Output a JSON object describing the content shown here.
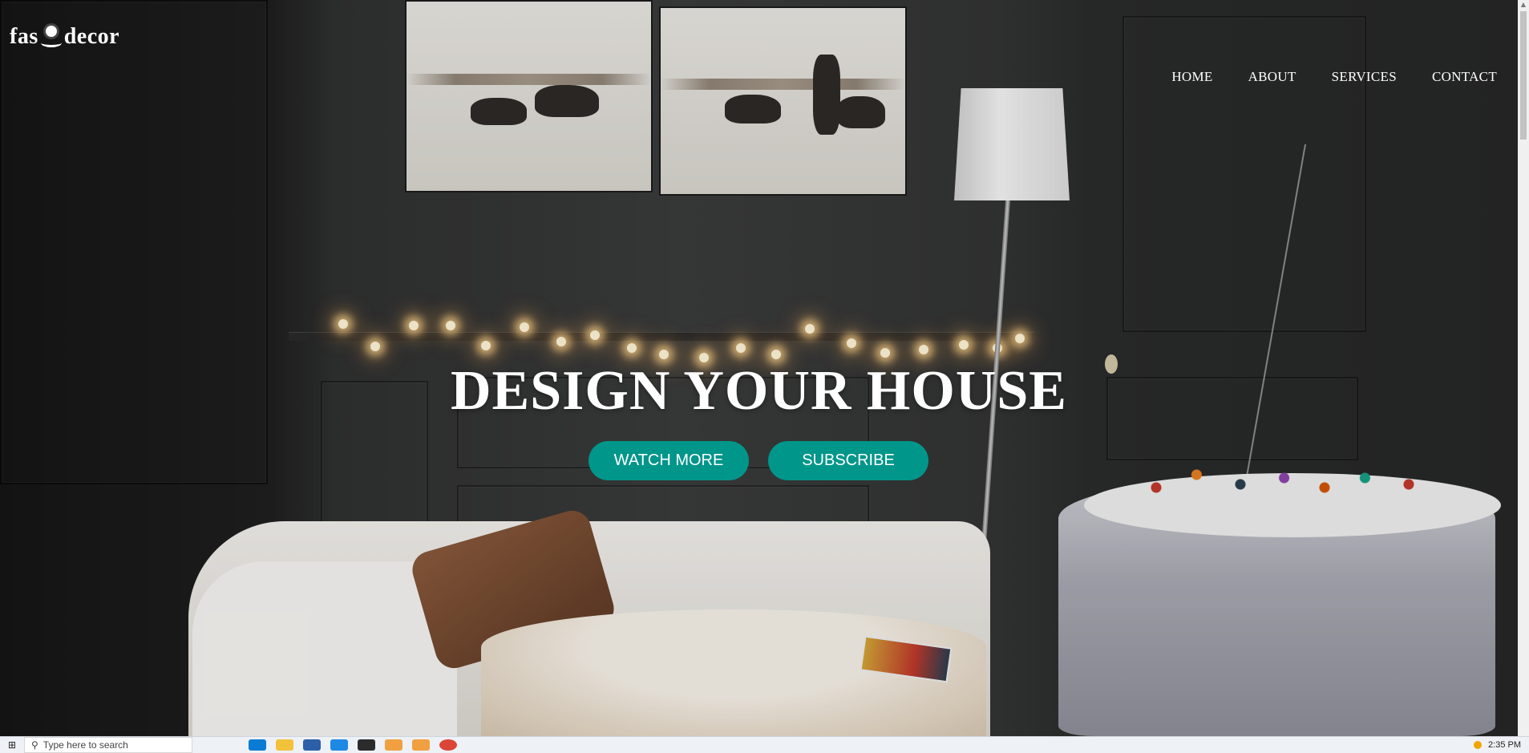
{
  "brand": {
    "logo_left": "fas",
    "logo_right": "decor"
  },
  "nav": {
    "items": [
      {
        "label": "HOME"
      },
      {
        "label": "ABOUT"
      },
      {
        "label": "SERVICES"
      },
      {
        "label": "CONTACT"
      }
    ]
  },
  "hero": {
    "title": "DESIGN YOUR HOUSE",
    "watch_label": "WATCH MORE",
    "subscribe_label": "SUBSCRIBE"
  },
  "taskbar": {
    "search_placeholder": "Type here to search",
    "clock": "2:35 PM"
  },
  "colors": {
    "accent": "#00968a",
    "text": "#ffffff"
  },
  "icons": [
    "sun-wave-logo-icon",
    "windows-start-icon",
    "search-icon",
    "edge-icon",
    "file-explorer-icon",
    "store-icon",
    "vscode-icon",
    "terminal-icon",
    "chrome-icon"
  ]
}
